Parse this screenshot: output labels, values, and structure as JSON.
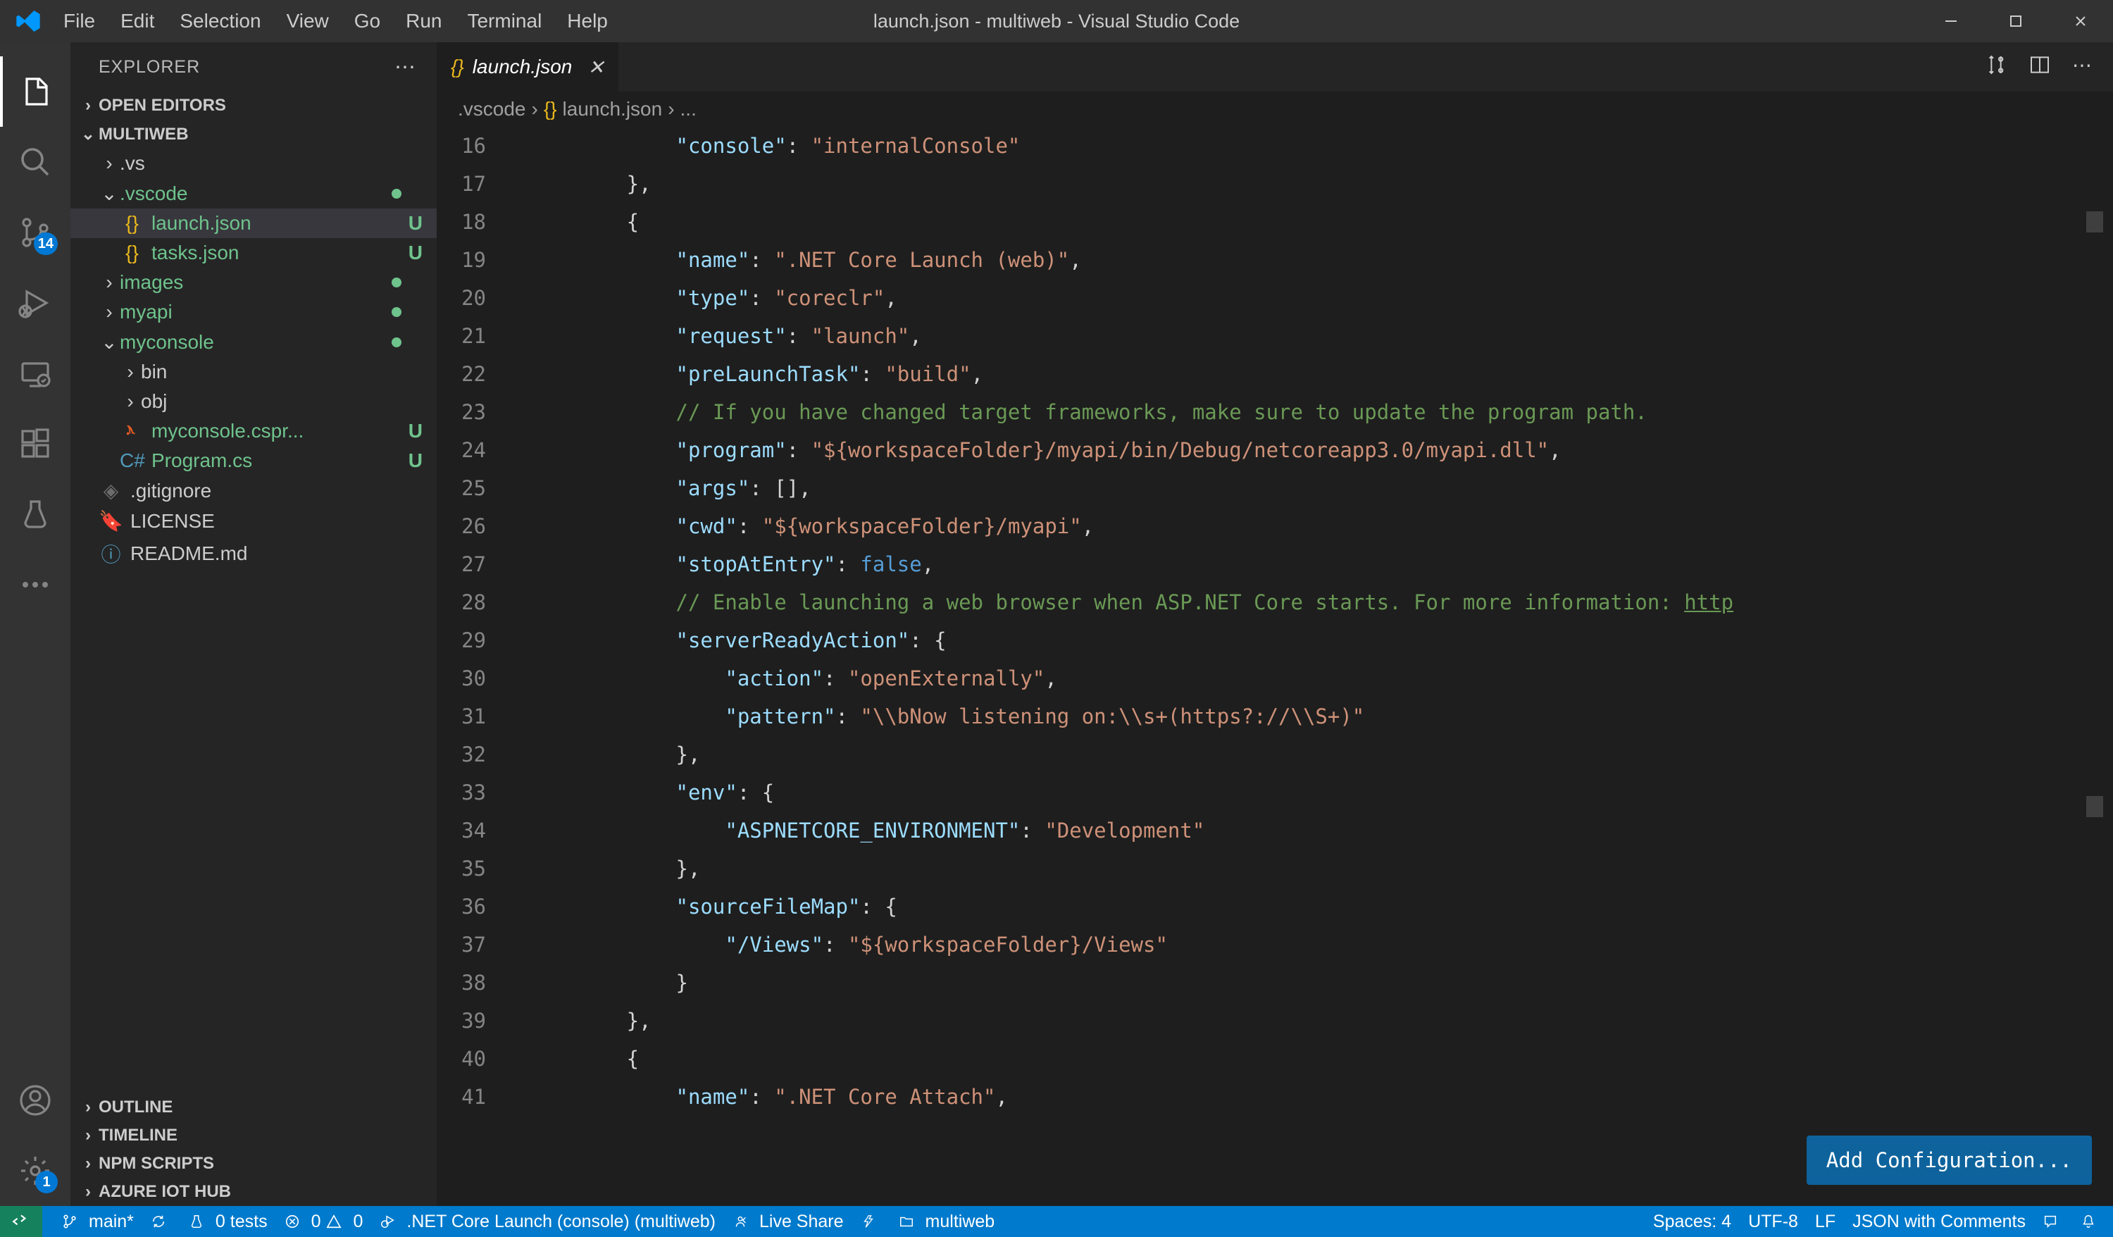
{
  "window": {
    "title": "launch.json - multiweb - Visual Studio Code"
  },
  "menubar": {
    "file": "File",
    "edit": "Edit",
    "selection": "Selection",
    "view": "View",
    "go": "Go",
    "run": "Run",
    "terminal": "Terminal",
    "help": "Help"
  },
  "activity": {
    "sourceControlBadge": "14",
    "settingsBadge": "1"
  },
  "sidebar": {
    "title": "EXPLORER",
    "openEditors": "OPEN EDITORS",
    "workspace": "MULTIWEB",
    "tree": {
      "vs": ".vs",
      "vscode": ".vscode",
      "launchjson": "launch.json",
      "tasksjson": "tasks.json",
      "images": "images",
      "myapi": "myapi",
      "myconsole": "myconsole",
      "bin": "bin",
      "obj": "obj",
      "myconsoleCsproj": "myconsole.cspr...",
      "programCs": "Program.cs",
      "gitignore": ".gitignore",
      "license": "LICENSE",
      "readme": "README.md",
      "statusU": "U"
    },
    "outline": "OUTLINE",
    "timeline": "TIMELINE",
    "npmScripts": "NPM SCRIPTS",
    "azureIot": "AZURE IOT HUB"
  },
  "tab": {
    "filename": "launch.json"
  },
  "breadcrumbs": {
    "folder": ".vscode",
    "file": "launch.json",
    "trail": "..."
  },
  "code": {
    "lineStart": 16,
    "lines": [
      {
        "n": 16,
        "parts": [
          {
            "t": "            ",
            "c": ""
          },
          {
            "t": "\"console\"",
            "c": "key"
          },
          {
            "t": ": ",
            "c": "punct"
          },
          {
            "t": "\"internalConsole\"",
            "c": "string"
          }
        ]
      },
      {
        "n": 17,
        "parts": [
          {
            "t": "        },",
            "c": "punct"
          }
        ]
      },
      {
        "n": 18,
        "parts": [
          {
            "t": "        {",
            "c": "punct"
          }
        ]
      },
      {
        "n": 19,
        "parts": [
          {
            "t": "            ",
            "c": ""
          },
          {
            "t": "\"name\"",
            "c": "key"
          },
          {
            "t": ": ",
            "c": "punct"
          },
          {
            "t": "\".NET Core Launch (web)\"",
            "c": "string"
          },
          {
            "t": ",",
            "c": "punct"
          }
        ]
      },
      {
        "n": 20,
        "parts": [
          {
            "t": "            ",
            "c": ""
          },
          {
            "t": "\"type\"",
            "c": "key"
          },
          {
            "t": ": ",
            "c": "punct"
          },
          {
            "t": "\"coreclr\"",
            "c": "string"
          },
          {
            "t": ",",
            "c": "punct"
          }
        ]
      },
      {
        "n": 21,
        "parts": [
          {
            "t": "            ",
            "c": ""
          },
          {
            "t": "\"request\"",
            "c": "key"
          },
          {
            "t": ": ",
            "c": "punct"
          },
          {
            "t": "\"launch\"",
            "c": "string"
          },
          {
            "t": ",",
            "c": "punct"
          }
        ]
      },
      {
        "n": 22,
        "parts": [
          {
            "t": "            ",
            "c": ""
          },
          {
            "t": "\"preLaunchTask\"",
            "c": "key"
          },
          {
            "t": ": ",
            "c": "punct"
          },
          {
            "t": "\"build\"",
            "c": "string"
          },
          {
            "t": ",",
            "c": "punct"
          }
        ]
      },
      {
        "n": 23,
        "parts": [
          {
            "t": "            ",
            "c": ""
          },
          {
            "t": "// If you have changed target frameworks, make sure to update the program path.",
            "c": "comment"
          }
        ]
      },
      {
        "n": 24,
        "parts": [
          {
            "t": "            ",
            "c": ""
          },
          {
            "t": "\"program\"",
            "c": "key"
          },
          {
            "t": ": ",
            "c": "punct"
          },
          {
            "t": "\"${workspaceFolder}/myapi/bin/Debug/netcoreapp3.0/myapi.dll\"",
            "c": "string"
          },
          {
            "t": ",",
            "c": "punct"
          }
        ]
      },
      {
        "n": 25,
        "parts": [
          {
            "t": "            ",
            "c": ""
          },
          {
            "t": "\"args\"",
            "c": "key"
          },
          {
            "t": ": [],",
            "c": "punct"
          }
        ]
      },
      {
        "n": 26,
        "parts": [
          {
            "t": "            ",
            "c": ""
          },
          {
            "t": "\"cwd\"",
            "c": "key"
          },
          {
            "t": ": ",
            "c": "punct"
          },
          {
            "t": "\"${workspaceFolder}/myapi\"",
            "c": "string"
          },
          {
            "t": ",",
            "c": "punct"
          }
        ]
      },
      {
        "n": 27,
        "parts": [
          {
            "t": "            ",
            "c": ""
          },
          {
            "t": "\"stopAtEntry\"",
            "c": "key"
          },
          {
            "t": ": ",
            "c": "punct"
          },
          {
            "t": "false",
            "c": "const"
          },
          {
            "t": ",",
            "c": "punct"
          }
        ]
      },
      {
        "n": 28,
        "parts": [
          {
            "t": "            ",
            "c": ""
          },
          {
            "t": "// Enable launching a web browser when ASP.NET Core starts. For more information: ",
            "c": "comment"
          },
          {
            "t": "http",
            "c": "link"
          }
        ]
      },
      {
        "n": 29,
        "parts": [
          {
            "t": "            ",
            "c": ""
          },
          {
            "t": "\"serverReadyAction\"",
            "c": "key"
          },
          {
            "t": ": {",
            "c": "punct"
          }
        ]
      },
      {
        "n": 30,
        "parts": [
          {
            "t": "                ",
            "c": ""
          },
          {
            "t": "\"action\"",
            "c": "key"
          },
          {
            "t": ": ",
            "c": "punct"
          },
          {
            "t": "\"openExternally\"",
            "c": "string"
          },
          {
            "t": ",",
            "c": "punct"
          }
        ]
      },
      {
        "n": 31,
        "parts": [
          {
            "t": "                ",
            "c": ""
          },
          {
            "t": "\"pattern\"",
            "c": "key"
          },
          {
            "t": ": ",
            "c": "punct"
          },
          {
            "t": "\"\\\\bNow listening on:\\\\s+(https?://\\\\S+)\"",
            "c": "string"
          }
        ]
      },
      {
        "n": 32,
        "parts": [
          {
            "t": "            },",
            "c": "punct"
          }
        ]
      },
      {
        "n": 33,
        "parts": [
          {
            "t": "            ",
            "c": ""
          },
          {
            "t": "\"env\"",
            "c": "key"
          },
          {
            "t": ": {",
            "c": "punct"
          }
        ]
      },
      {
        "n": 34,
        "parts": [
          {
            "t": "                ",
            "c": ""
          },
          {
            "t": "\"ASPNETCORE_ENVIRONMENT\"",
            "c": "key"
          },
          {
            "t": ": ",
            "c": "punct"
          },
          {
            "t": "\"Development\"",
            "c": "string"
          }
        ]
      },
      {
        "n": 35,
        "parts": [
          {
            "t": "            },",
            "c": "punct"
          }
        ]
      },
      {
        "n": 36,
        "parts": [
          {
            "t": "            ",
            "c": ""
          },
          {
            "t": "\"sourceFileMap\"",
            "c": "key"
          },
          {
            "t": ": {",
            "c": "punct"
          }
        ]
      },
      {
        "n": 37,
        "parts": [
          {
            "t": "                ",
            "c": ""
          },
          {
            "t": "\"/Views\"",
            "c": "key"
          },
          {
            "t": ": ",
            "c": "punct"
          },
          {
            "t": "\"${workspaceFolder}/Views\"",
            "c": "string"
          }
        ]
      },
      {
        "n": 38,
        "parts": [
          {
            "t": "            }",
            "c": "punct"
          }
        ]
      },
      {
        "n": 39,
        "parts": [
          {
            "t": "        },",
            "c": "punct"
          }
        ]
      },
      {
        "n": 40,
        "parts": [
          {
            "t": "        {",
            "c": "punct"
          }
        ]
      },
      {
        "n": 41,
        "parts": [
          {
            "t": "            ",
            "c": ""
          },
          {
            "t": "\"name\"",
            "c": "key"
          },
          {
            "t": ": ",
            "c": "punct"
          },
          {
            "t": "\".NET Core Attach\"",
            "c": "string"
          },
          {
            "t": ",",
            "c": "punct"
          }
        ]
      }
    ]
  },
  "addConfigButton": "Add Configuration...",
  "statusbar": {
    "branch": "main*",
    "tests": "0 tests",
    "errors": "0",
    "warnings": "0",
    "debugTarget": ".NET Core Launch (console) (multiweb)",
    "liveShare": "Live Share",
    "folder": "multiweb",
    "spaces": "Spaces: 4",
    "encoding": "UTF-8",
    "eol": "LF",
    "language": "JSON with Comments"
  }
}
